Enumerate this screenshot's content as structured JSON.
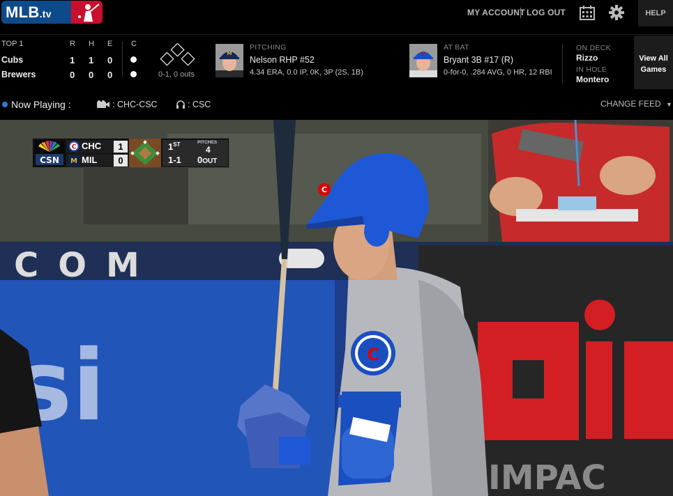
{
  "header": {
    "logo_text": "MLB",
    "logo_suffix": ".tv",
    "my_account": "MY ACCOUNT",
    "log_out": "LOG OUT",
    "help": "HELP"
  },
  "linescore": {
    "inning": "TOP 1",
    "headers": {
      "r": "R",
      "h": "H",
      "e": "E",
      "c": "C"
    },
    "teams": [
      {
        "name": "Cubs",
        "r": "1",
        "h": "1",
        "e": "0"
      },
      {
        "name": "Brewers",
        "r": "0",
        "h": "0",
        "e": "0"
      }
    ],
    "count_outs": "0-1, 0 outs"
  },
  "pitching": {
    "label": "PITCHING",
    "name": "Nelson RHP #52",
    "stats": "4.34 ERA, 0.0 IP, 0K, 3P (2S, 1B)"
  },
  "at_bat": {
    "label": "AT BAT",
    "name": "Bryant 3B #17 (R)",
    "stats": "0-for-0, .284 AVG, 0 HR, 12 RBI"
  },
  "on_deck": {
    "label": "ON DECK",
    "name": "Rizzo"
  },
  "in_hole": {
    "label": "IN HOLE",
    "name": "Montero"
  },
  "view_all": {
    "line1": "View All",
    "line2": "Games"
  },
  "now_playing": {
    "label": "Now Playing :",
    "video_feed": ": CHC-CSC",
    "audio_feed": ": CSC",
    "change_feed": "CHANGE FEED"
  },
  "score_bug": {
    "network": "CSN",
    "away": {
      "abbr": "CHC",
      "score": "1"
    },
    "home": {
      "abbr": "MIL",
      "score": "0"
    },
    "inning_num": "1",
    "inning_suffix": "ST",
    "pitches_label": "PITCHES",
    "pitches": "4",
    "count": "1-1",
    "outs_num": "0",
    "outs_label": "OUT"
  },
  "colors": {
    "mlb_blue": "#0e4a8a",
    "mlb_red": "#c8102e",
    "cubs_blue": "#1a4fc0",
    "now_playing_dot": "#2b7fd8"
  }
}
